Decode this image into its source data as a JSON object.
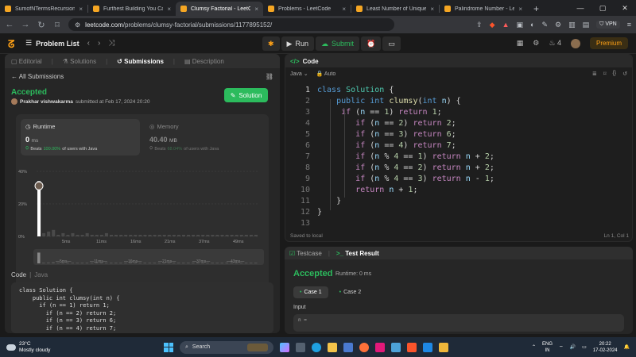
{
  "browser": {
    "tabs": [
      {
        "label": "SumofNTermsRecursionJava",
        "active": false,
        "color": "#f5a623"
      },
      {
        "label": "Furthest Building You Can Reac",
        "active": false,
        "color": "#f5a623"
      },
      {
        "label": "Clumsy Factorial - LeetCode",
        "active": true,
        "color": "#f5a623"
      },
      {
        "label": "Problems - LeetCode",
        "active": false,
        "color": "#f5a623"
      },
      {
        "label": "Least Number of Unique Integ",
        "active": false,
        "color": "#f5a623"
      },
      {
        "label": "Palindrome Number - LeetCode",
        "active": false,
        "color": "#f5a623"
      }
    ],
    "new_tab": "+",
    "url_host": "leetcode.com",
    "url_path": "/problems/clumsy-factorial/submissions/1177895152/",
    "vpn_label": "VPN"
  },
  "header": {
    "problem_list": "Problem List",
    "run": "Run",
    "submit": "Submit",
    "streak": "4",
    "premium": "Premium"
  },
  "left": {
    "tabs": [
      "Editorial",
      "Solutions",
      "Submissions",
      "Description"
    ],
    "all_submissions": "All Submissions",
    "status": "Accepted",
    "submitter_name": "Prakhar vishwakarma",
    "submitted_at": "submitted at Feb 17, 2024 20:20",
    "solution_button": "Solution",
    "runtime": {
      "label": "Runtime",
      "value": "0",
      "unit": "ms",
      "beats_prefix": "Beats",
      "beats_pct": "100.00%",
      "beats_suffix": "of users with Java"
    },
    "memory": {
      "label": "Memory",
      "value": "40.40",
      "unit": "MB",
      "beats_prefix": "Beats",
      "beats_pct": "68.04%",
      "beats_suffix": "of users with Java"
    },
    "code_label": "Code",
    "code_lang": "Java",
    "code_preview": "class Solution {\n    public int clumsy(int n) {\n      if (n == 1) return 1;\n        if (n == 2) return 2;\n        if (n == 3) return 6;\n        if (n == 4) return 7;"
  },
  "chart_data": {
    "type": "bar",
    "title": "",
    "xlabel": "",
    "ylabel": "",
    "ylim": [
      0,
      40
    ],
    "yticks": [
      "40%",
      "20%",
      "0%"
    ],
    "xticks": [
      "5ms",
      "11ms",
      "16ms",
      "21ms",
      "37ms",
      "49ms"
    ],
    "mini_xticks": [
      "5ms",
      "11ms",
      "16ms",
      "21ms",
      "37ms",
      "43ms"
    ],
    "values": [
      34,
      2,
      3,
      4,
      1,
      2,
      1,
      2,
      1,
      1,
      2,
      1,
      1,
      1,
      2,
      1,
      1,
      1,
      1,
      1,
      1,
      1,
      1,
      1,
      1,
      1,
      1,
      1,
      1,
      1,
      1,
      1,
      1,
      1,
      1,
      1,
      1,
      1,
      1,
      1,
      1,
      1,
      1,
      1,
      1,
      1
    ],
    "highlight_index": 0,
    "grid": true,
    "colors": {
      "highlight": "#ffffff",
      "bar": "#4a4a4a"
    }
  },
  "editor": {
    "title": "Code",
    "language": "Java",
    "mode": "Auto",
    "lines": [
      "1",
      "2",
      "3",
      "4",
      "5",
      "6",
      "7",
      "8",
      "9",
      "10",
      "11",
      "12",
      "13"
    ],
    "saved": "Saved to local",
    "cursor": "Ln 1, Col 1"
  },
  "result": {
    "tabs": [
      "Testcase",
      "Test Result"
    ],
    "status": "Accepted",
    "runtime": "Runtime: 0 ms",
    "cases": [
      "Case 1",
      "Case 2"
    ],
    "input_label": "Input",
    "input_var": "n ="
  },
  "taskbar": {
    "temp": "23°C",
    "weather": "Mostly cloudy",
    "search": "Search",
    "lang": "ENG",
    "region": "IN",
    "time": "20:22",
    "date": "17-02-2024"
  }
}
